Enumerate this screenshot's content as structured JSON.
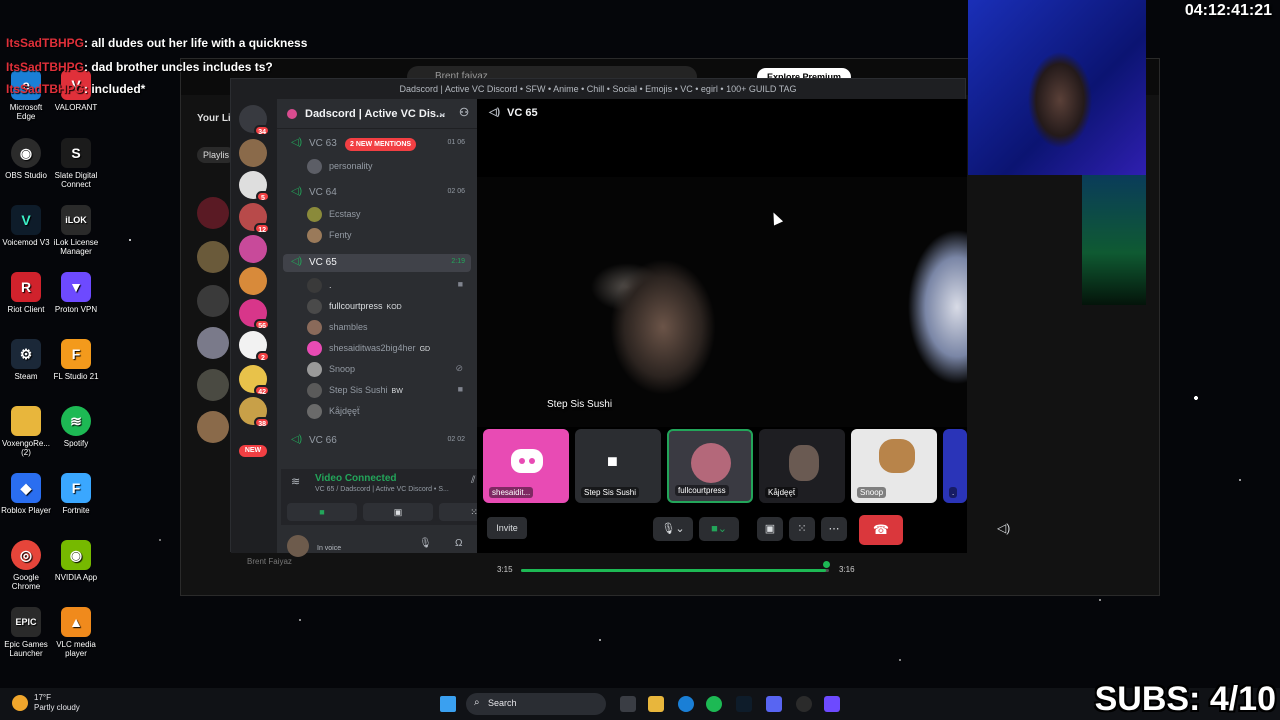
{
  "chat": {
    "lines": [
      {
        "nick": "ItsSadTBHPG",
        "msg": ": all dudes out her life with a quickness"
      },
      {
        "nick": "ItsSadTBHPG",
        "msg": ": dad brother uncles includes ts?"
      },
      {
        "nick": "ItsSadTBHPG",
        "msg": ": included*"
      }
    ]
  },
  "desktop": {
    "icons": [
      {
        "label": "Microsoft Edge",
        "icon": "edge-icon",
        "color": "#1a7fd6"
      },
      {
        "label": "VALORANT",
        "icon": "valorant-icon",
        "color": "#e0303a"
      },
      {
        "label": "OBS Studio",
        "icon": "obs-icon",
        "color": "#2b2b2b"
      },
      {
        "label": "Slate Digital Connect",
        "icon": "slate-icon",
        "color": "#1b1b1b"
      },
      {
        "label": "Voicemod V3",
        "icon": "voicemod-icon",
        "color": "#0e1c2a"
      },
      {
        "label": "iLok License Manager",
        "icon": "ilok-icon",
        "color": "#2a2a2a"
      },
      {
        "label": "Riot Client",
        "icon": "riot-icon",
        "color": "#d0222c"
      },
      {
        "label": "Proton VPN",
        "icon": "proton-icon",
        "color": "#6d4aff"
      },
      {
        "label": "Steam",
        "icon": "steam-icon",
        "color": "#1b2838"
      },
      {
        "label": "FL Studio 21",
        "icon": "fl-studio-icon",
        "color": "#f39a1c"
      },
      {
        "label": "VoxengoRe... (2)",
        "icon": "folder-icon",
        "color": "#e8b63c"
      },
      {
        "label": "Spotify",
        "icon": "spotify-icon",
        "color": "#1db954"
      },
      {
        "label": "Roblox Player",
        "icon": "roblox-icon",
        "color": "#2a6ef0"
      },
      {
        "label": "Fortnite",
        "icon": "fortnite-icon",
        "color": "#3aa7ff"
      },
      {
        "label": "Google Chrome",
        "icon": "chrome-icon",
        "color": "#e6453a"
      },
      {
        "label": "NVIDIA App",
        "icon": "nvidia-icon",
        "color": "#76b900"
      },
      {
        "label": "Epic Games Launcher",
        "icon": "epic-icon",
        "color": "#2a2a2a"
      },
      {
        "label": "VLC media player",
        "icon": "vlc-icon",
        "color": "#f08a1c"
      }
    ]
  },
  "spotify": {
    "search_placeholder": "Brent faiyaz",
    "premium_label": "Explore Premium",
    "your_library": "Your Li",
    "playlists_chip": "Playlis",
    "artist": "Brent Faiyaz",
    "time_elapsed": "3:15",
    "time_total": "3:16",
    "progress": 0.99
  },
  "discord": {
    "window_title": "Dadscord | Active VC Discord • SFW • Anime • Chill • Social • Emojis • VC • egirl • 100+ GUILD TAG",
    "guild_name": "Dadscord | Active VC Dis...",
    "server_badges": [
      "34",
      "5",
      "12",
      "56",
      "2",
      "42",
      "38"
    ],
    "new_pill": "NEW",
    "channels": [
      {
        "name": "VC 63",
        "count_a": "01",
        "count_b": "06",
        "mentions": "2 NEW MENTIONS"
      },
      {
        "name": "VC 64",
        "count_a": "02",
        "count_b": "06"
      },
      {
        "name": "VC 65",
        "timer": "2:19"
      },
      {
        "name": "VC 66",
        "count_a": "02",
        "count_b": "02"
      }
    ],
    "vc63_members": [
      "personality"
    ],
    "vc64_members": [
      "Ecstasy",
      "Fenty"
    ],
    "vc65_members": [
      {
        "name": ".",
        "tag": ""
      },
      {
        "name": "fullcourtpress",
        "tag": "KOD"
      },
      {
        "name": "shambles",
        "tag": ""
      },
      {
        "name": "shesaiditwas2big4her",
        "tag": "GD"
      },
      {
        "name": "Snoop",
        "tag": ""
      },
      {
        "name": "Step Sis Sushi",
        "tag": "BW"
      },
      {
        "name": "Kåjdęęẗ",
        "tag": ""
      }
    ],
    "voice_status": "Video Connected",
    "voice_sub": "VC 65 / Dadscord | Active VC Discord • S...",
    "user_status": "In voice",
    "stage_channel": "VC 65",
    "main_video_name": "Step Sis Sushi",
    "tiles": [
      "shesaidit...",
      "Step Sis Sushi",
      "fullcourtpress",
      "Kåjdęęẗ",
      "Snoop",
      "."
    ],
    "invite_label": "Invite"
  },
  "stream": {
    "clock": "04:12:41:21",
    "subs": "SUBS: 4/10"
  },
  "taskbar": {
    "temp": "17°F",
    "weather": "Partly cloudy",
    "search": "Search"
  }
}
